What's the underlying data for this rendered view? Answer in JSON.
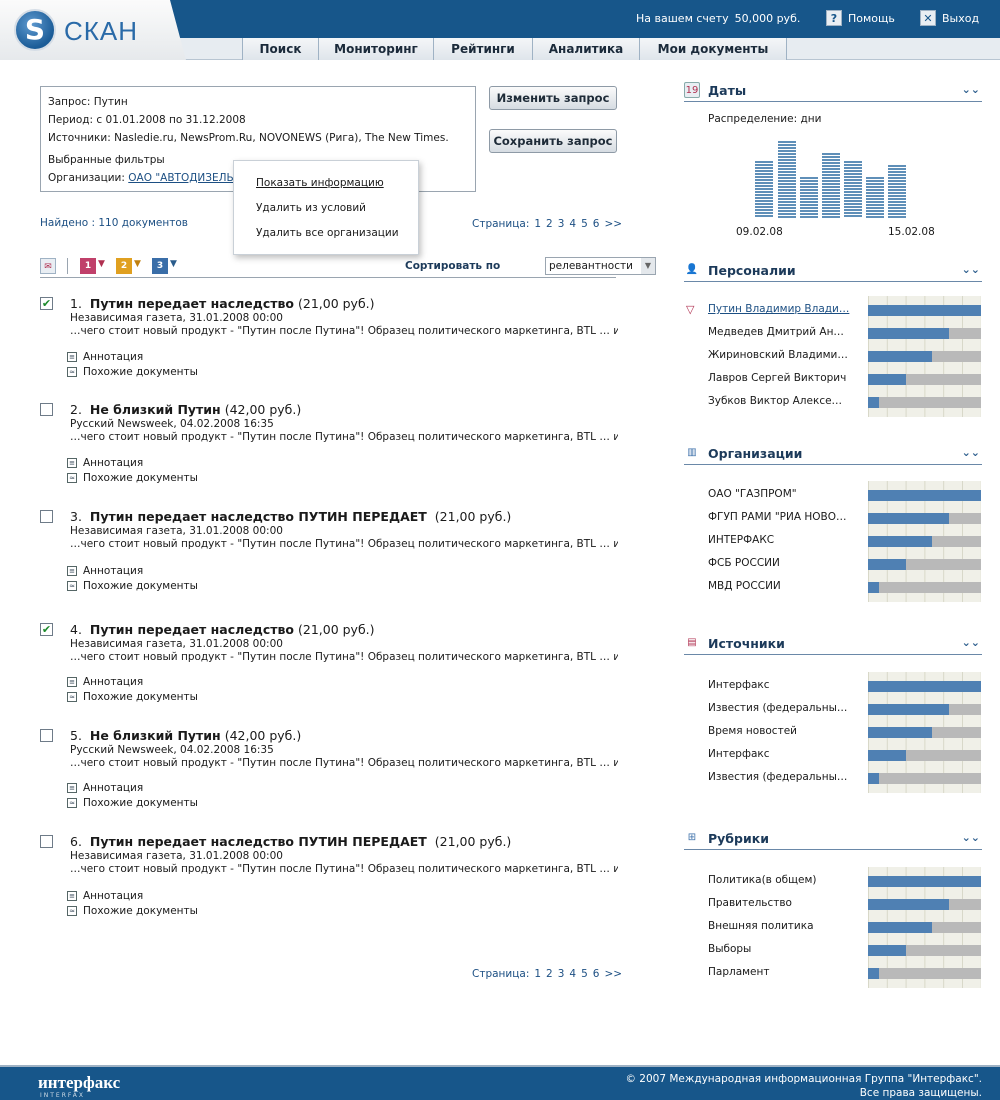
{
  "header": {
    "logo_text": "СКАН",
    "account_label": "На вашем счету",
    "account_value": "50,000 руб.",
    "help_label": "Помощь",
    "exit_label": "Выход"
  },
  "nav": [
    "Поиск",
    "Мониторинг",
    "Рейтинги",
    "Аналитика",
    "Мои документы"
  ],
  "query": {
    "request": "Запрос: Путин",
    "period": "Период: с 01.01.2008 по 31.12.2008",
    "sources": "Источники: Nasledie.ru, NewsProm.Ru, NOVONEWS (Рига), The New Times.",
    "filters_label": "Выбранные фильтры",
    "orgs_label": "Организации:",
    "org_value": "ОАО \"АВТОДИЗЕЛЬ\"",
    "change_button": "Изменить запрос",
    "save_button": "Сохранить запрос"
  },
  "popup": [
    "Показать информацию",
    "Удалить из условий",
    "Удалить все организации"
  ],
  "found_text": "Найдено : 110 документов",
  "pager": {
    "label": "Страница:",
    "pages": [
      "1",
      "2",
      "3",
      "4",
      "5",
      "6",
      ">>"
    ]
  },
  "sort": {
    "label": "Сортировать по",
    "value": "релевантности"
  },
  "results": [
    {
      "num": "1.",
      "title": "Путин передает наследство",
      "price": "(21,00 руб.)",
      "source": "Независимая газета, 31.01.2008 00:00",
      "snippet": "…чего стоит новый продукт - \"Путин после Путина\"! Образец политического маркетинга, BTL … и росс…",
      "checked": "✔",
      "annotation": "Аннотация",
      "similar": "Похожие документы"
    },
    {
      "num": "2.",
      "title": "Не близкий Путин",
      "price": "(42,00 руб.)",
      "source": "Русский Newsweek, 04.02.2008 16:35",
      "snippet": "…чего стоит новый продукт - \"Путин после Путина\"! Образец политического маркетинга, BTL … и росс…",
      "checked": "",
      "annotation": "Аннотация",
      "similar": "Похожие документы"
    },
    {
      "num": "3.",
      "title": "Путин передает наследство ПУТИН ПЕРЕДАЕТ",
      "price": "(21,00 руб.)",
      "source": "Независимая газета, 31.01.2008 00:00",
      "snippet": "…чего стоит новый продукт - \"Путин после Путина\"! Образец политического маркетинга, BTL … и росс…",
      "checked": "",
      "annotation": "Аннотация",
      "similar": "Похожие документы"
    },
    {
      "num": "4.",
      "title": "Путин передает наследство",
      "price": "(21,00 руб.)",
      "source": "Независимая газета, 31.01.2008 00:00",
      "snippet": "…чего стоит новый продукт - \"Путин после Путина\"! Образец политического маркетинга, BTL … и росс…",
      "checked": "✔",
      "annotation": "Аннотация",
      "similar": "Похожие документы"
    },
    {
      "num": "5.",
      "title": "Не близкий Путин",
      "price": "(42,00 руб.)",
      "source": "Русский Newsweek, 04.02.2008 16:35",
      "snippet": "…чего стоит новый продукт - \"Путин после Путина\"! Образец политического маркетинга, BTL … и росс…",
      "checked": "",
      "annotation": "Аннотация",
      "similar": "Похожие документы"
    },
    {
      "num": "6.",
      "title": "Путин передает наследство ПУТИН ПЕРЕДАЕТ",
      "price": "(21,00 руб.)",
      "source": "Независимая газета, 31.01.2008 00:00",
      "snippet": "…чего стоит новый продукт - \"Путин после Путина\"! Образец политического маркетинга, BTL … и росс…",
      "checked": "",
      "annotation": "Аннотация",
      "similar": "Похожие документы"
    }
  ],
  "dates": {
    "title": "Даты",
    "distribution_label": "Распределение: дни",
    "start_label": "09.02.08",
    "end_label": "15.02.08"
  },
  "persons": {
    "title": "Персоналии",
    "items": [
      {
        "label": "Путин Владимир Влади…",
        "share": 1.0
      },
      {
        "label": "Медведев Дмитрий Ан…",
        "share": 0.72
      },
      {
        "label": "Жириновский Владими…",
        "share": 0.57
      },
      {
        "label": "Лавров Сергей Викторич",
        "share": 0.34
      },
      {
        "label": "Зубков Виктор Алексе…",
        "share": 0.1
      }
    ]
  },
  "orgs": {
    "title": "Организации",
    "items": [
      {
        "label": "ОАО \"ГАЗПРОМ\"",
        "share": 1.0
      },
      {
        "label": "ФГУП РАМИ \"РИА НОВО…",
        "share": 0.72
      },
      {
        "label": "ИНТЕРФАКС",
        "share": 0.57
      },
      {
        "label": "ФСБ РОССИИ",
        "share": 0.34
      },
      {
        "label": "МВД РОССИИ",
        "share": 0.1
      }
    ]
  },
  "sources": {
    "title": "Источники",
    "items": [
      {
        "label": "Интерфакс",
        "share": 1.0
      },
      {
        "label": "Известия (федеральны…",
        "share": 0.72
      },
      {
        "label": "Время новостей",
        "share": 0.57
      },
      {
        "label": "Интерфакс",
        "share": 0.34
      },
      {
        "label": "Известия (федеральны…",
        "share": 0.1
      }
    ]
  },
  "rubrics": {
    "title": "Рубрики",
    "items": [
      {
        "label": "Политика(в общем)",
        "share": 1.0
      },
      {
        "label": "Правительство",
        "share": 0.72
      },
      {
        "label": "Внешняя политика",
        "share": 0.57
      },
      {
        "label": "Выборы",
        "share": 0.34
      },
      {
        "label": "Парламент",
        "share": 0.1
      }
    ]
  },
  "footer": {
    "logo": "интерфакс",
    "logo_sub": "INTERFAX",
    "copyright": "© 2007 Международная информационная Группа \"Интерфакс\".",
    "rights": "Все права защищены."
  },
  "colors": {
    "brand": "#17568a",
    "bar": "#4f80b3",
    "link": "#1c4f83"
  }
}
